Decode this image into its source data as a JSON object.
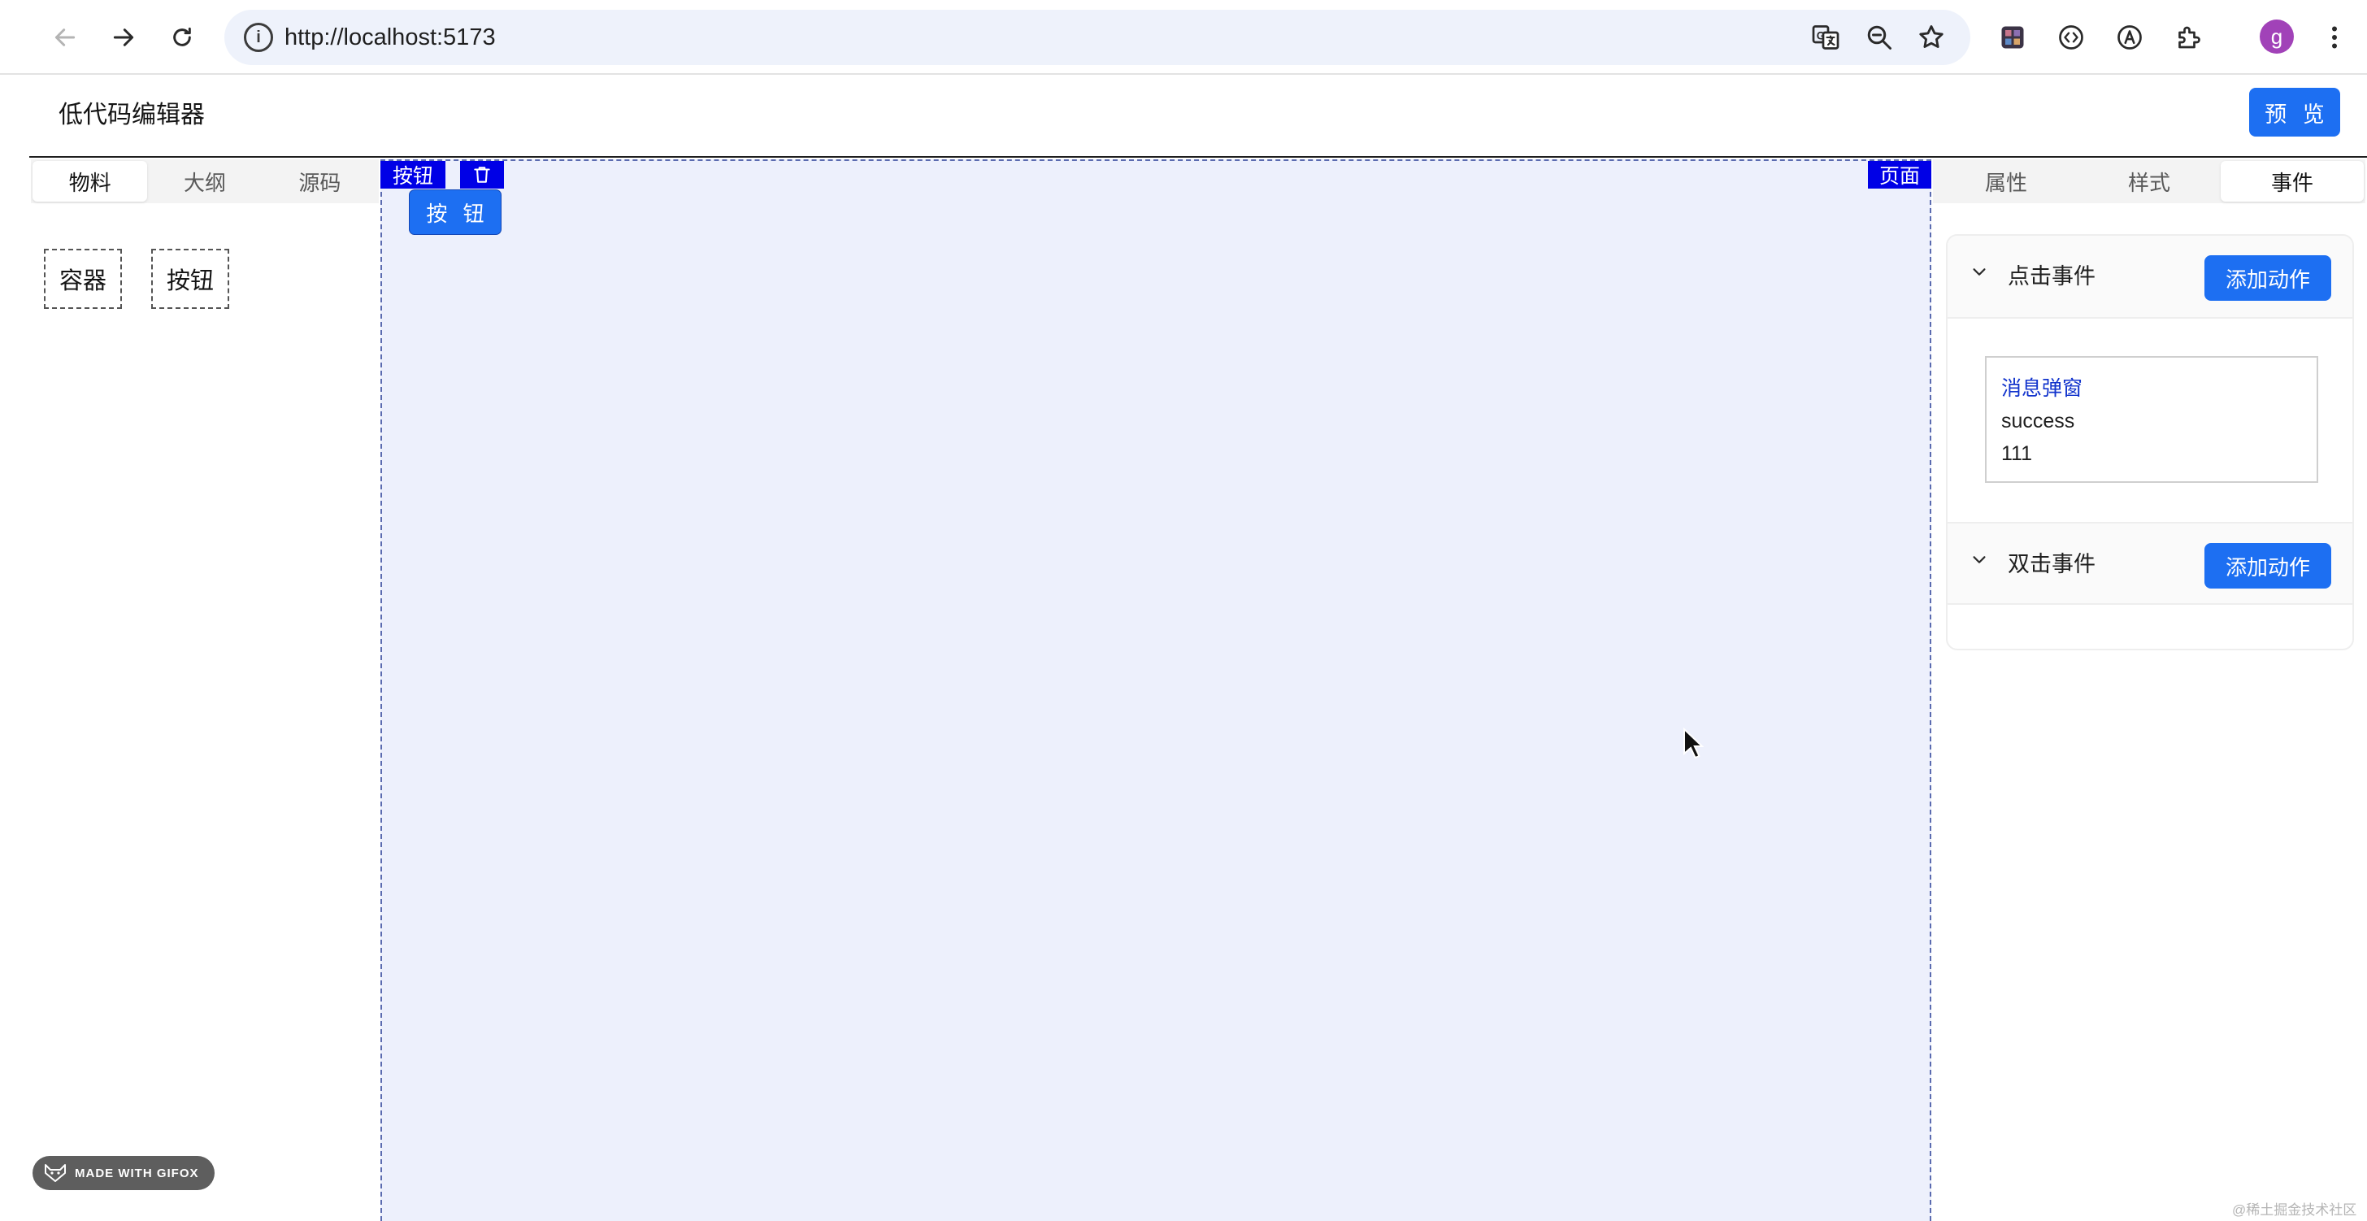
{
  "browser": {
    "url": "http://localhost:5173",
    "profile_initial": "g",
    "toolbar_icons": [
      "back-arrow-icon",
      "forward-arrow-icon",
      "reload-icon",
      "site-info-icon",
      "translate-icon",
      "zoom-out-icon",
      "bookmark-star-icon",
      "extension-app-icon",
      "extension-code-icon",
      "extension-text-icon",
      "extensions-puzzle-icon",
      "profile-avatar",
      "more-menu-icon"
    ]
  },
  "app": {
    "title": "低代码编辑器",
    "preview_label": "预 览"
  },
  "left_panel": {
    "tabs": [
      {
        "label": "物料",
        "active": true
      },
      {
        "label": "大纲",
        "active": false
      },
      {
        "label": "源码",
        "active": false
      }
    ],
    "materials": [
      {
        "label": "容器"
      },
      {
        "label": "按钮"
      }
    ]
  },
  "canvas": {
    "selected_tag": "按钮",
    "page_tag": "页面",
    "button_label": "按 钮"
  },
  "right_panel": {
    "tabs": [
      {
        "label": "属性",
        "active": false
      },
      {
        "label": "样式",
        "active": false
      },
      {
        "label": "事件",
        "active": true
      }
    ],
    "events": [
      {
        "title": "点击事件",
        "add_label": "添加动作",
        "expanded": true,
        "actions": [
          {
            "type": "消息弹窗",
            "level": "success",
            "message": "111"
          }
        ]
      },
      {
        "title": "双击事件",
        "add_label": "添加动作",
        "expanded": true,
        "actions": []
      }
    ]
  },
  "overlay": {
    "gifox_label": "MADE WITH GIFOX",
    "watermark": "@稀土掘金技术社区"
  },
  "colors": {
    "primary": "#1d6ff2",
    "selection_tag": "#0000e6",
    "canvas_bg": "#edf0fc",
    "action_type_text": "#1133cc"
  }
}
